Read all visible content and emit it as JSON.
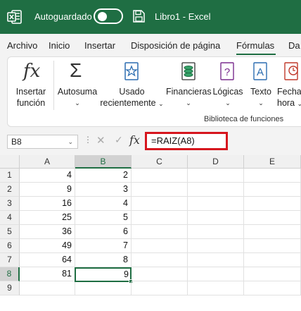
{
  "titlebar": {
    "autosave_label": "Autoguardado",
    "autosave_on": false,
    "document_title": "Libro1  -  Excel",
    "accent_color": "#1f6e43"
  },
  "menu": {
    "tabs": [
      "Archivo",
      "Inicio",
      "Insertar",
      "Disposición de página",
      "Fórmulas",
      "Da"
    ],
    "active_tab": "Fórmulas"
  },
  "ribbon": {
    "insert_function": {
      "line1": "Insertar",
      "line2": "función",
      "icon": "fx-icon"
    },
    "autosum": {
      "label": "Autosuma",
      "icon": "sigma-icon"
    },
    "recently_used": {
      "line1": "Usado",
      "line2": "recientemente",
      "icon": "star-icon"
    },
    "financial": {
      "label": "Financieras",
      "icon": "coins-icon"
    },
    "logical": {
      "label": "Lógicas",
      "icon": "question-icon"
    },
    "text": {
      "label": "Texto",
      "icon": "text-A-icon"
    },
    "datetime": {
      "line1": "Fecha",
      "line2": "hora",
      "icon": "clock-icon"
    },
    "group_label": "Biblioteca de funciones"
  },
  "formula_bar": {
    "name_box": "B8",
    "cancel_symbol": "✕",
    "enter_symbol": "✓",
    "fx_label": "fx",
    "formula": "=RAIZ(A8)"
  },
  "sheet": {
    "columns": [
      "A",
      "B",
      "C",
      "D",
      "E"
    ],
    "rows": [
      "1",
      "2",
      "3",
      "4",
      "5",
      "6",
      "7",
      "8",
      "9"
    ],
    "selected_column": "B",
    "selected_row": "8",
    "col_a": [
      "4",
      "9",
      "16",
      "25",
      "36",
      "49",
      "64",
      "81",
      ""
    ],
    "col_b": [
      "2",
      "3",
      "4",
      "5",
      "6",
      "7",
      "8",
      "9",
      ""
    ]
  }
}
